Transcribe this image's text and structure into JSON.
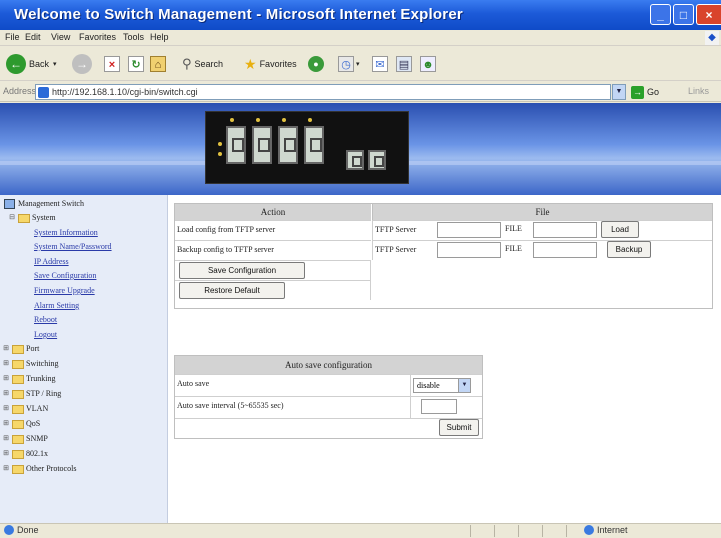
{
  "window": {
    "title": "Welcome to Switch Management - Microsoft Internet Explorer"
  },
  "menu": [
    "File",
    "Edit",
    "View",
    "Favorites",
    "Tools",
    "Help"
  ],
  "toolbar": {
    "back": "Back",
    "search": "Search",
    "favorites": "Favorites"
  },
  "address": {
    "label": "Address",
    "url": "http://192.168.1.10/cgi-bin/switch.cgi",
    "go": "Go",
    "links": "Links"
  },
  "sidebar": {
    "root": "Management Switch",
    "system": "System",
    "system_items": [
      "System Information",
      "System Name/Password",
      "IP Address",
      "Save Configuration",
      "Firmware Upgrade",
      "Alarm Setting",
      "Reboot",
      "Logout"
    ],
    "folders": [
      "Port",
      "Switching",
      "Trunking",
      "STP / Ring",
      "VLAN",
      "QoS",
      "SNMP",
      "802.1x",
      "Other Protocols"
    ]
  },
  "config_table": {
    "action_header": "Action",
    "file_header": "File",
    "load_row": {
      "label": "Load config from TFTP server",
      "server_label": "TFTP Server",
      "file_label": "FILE",
      "button": "Load"
    },
    "backup_row": {
      "label": "Backup config to TFTP server",
      "server_label": "TFTP Server",
      "file_label": "FILE",
      "button": "Backup"
    },
    "save_button": "Save Configuration",
    "restore_button": "Restore Default"
  },
  "autosave": {
    "header": "Auto save configuration",
    "auto_save_label": "Auto save",
    "auto_save_value": "disable",
    "interval_label": "Auto save interval (5~65535 sec)",
    "interval_value": "",
    "submit": "Submit"
  },
  "status": {
    "left": "Done",
    "zone": "Internet"
  }
}
